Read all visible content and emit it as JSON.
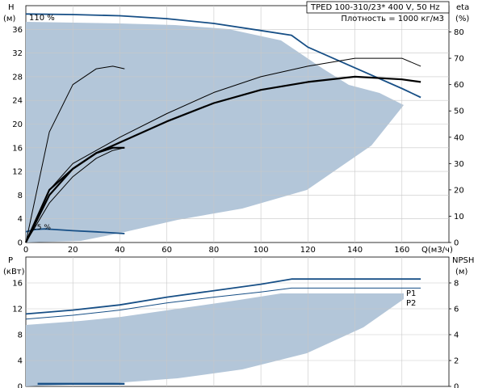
{
  "chart_data": [
    {
      "type": "line",
      "legend_box": {
        "model": "TPED 100-310/2",
        "supply": "3* 400 V, 50 Hz",
        "density": "Плотность = 1000 кг/м3"
      },
      "x_axis": {
        "label": "Q(м3/ч)",
        "range": [
          0,
          180
        ],
        "ticks": [
          0,
          20,
          40,
          60,
          80,
          100,
          120,
          140,
          160
        ]
      },
      "y_left": {
        "label": "H",
        "unit": "(м)",
        "range": [
          0,
          40
        ],
        "ticks": [
          0,
          4,
          8,
          12,
          16,
          20,
          24,
          28,
          32,
          36
        ]
      },
      "y_right": {
        "label": "eta",
        "unit": "(%)",
        "range": [
          0,
          90
        ],
        "ticks": [
          0,
          10,
          20,
          30,
          40,
          50,
          60,
          70,
          80
        ]
      },
      "annotations": {
        "max_speed": "110 %",
        "min_speed": "25 %"
      },
      "grid": true,
      "series": [
        {
          "role": "H",
          "x": [
            0,
            20,
            40,
            60,
            80,
            100,
            113,
            120,
            140,
            160,
            168
          ],
          "y": [
            38.6,
            38.5,
            38.3,
            37.8,
            37.0,
            35.8,
            35.0,
            33.0,
            29.5,
            26.0,
            24.5
          ]
        },
        {
          "role": "H",
          "x": [
            0,
            4,
            8,
            12,
            16,
            20,
            30,
            42
          ],
          "y": [
            1.8,
            2.2,
            2.3,
            2.2,
            2.1,
            2.0,
            1.8,
            1.5
          ]
        },
        {
          "role": "eta",
          "x": [
            0,
            10,
            20,
            30,
            40,
            60,
            80,
            100,
            120,
            140,
            160,
            168
          ],
          "y": [
            0,
            20,
            30,
            35,
            40,
            49,
            57,
            63,
            67,
            70,
            70,
            67
          ]
        },
        {
          "role": "eta",
          "x": [
            0,
            10,
            20,
            30,
            40,
            60,
            80,
            100,
            120,
            140,
            160,
            168
          ],
          "y": [
            0,
            18,
            28,
            34,
            38,
            46,
            53,
            58,
            61,
            63,
            62,
            61
          ]
        },
        {
          "role": "eta",
          "x": [
            0,
            10,
            20,
            30,
            37,
            42
          ],
          "y": [
            0,
            42,
            60,
            66,
            67,
            66
          ]
        },
        {
          "role": "eta",
          "x": [
            0,
            10,
            20,
            30,
            37,
            42
          ],
          "y": [
            0,
            20,
            28,
            34,
            36,
            36
          ]
        },
        {
          "role": "eta",
          "x": [
            0,
            10,
            20,
            30,
            37,
            42
          ],
          "y": [
            0,
            15,
            25,
            32,
            35,
            36
          ]
        }
      ]
    },
    {
      "type": "line",
      "x_axis": {
        "range": [
          0,
          180
        ]
      },
      "y_left": {
        "label": "P",
        "unit": "(кВт)",
        "range": [
          0,
          20
        ],
        "ticks": [
          0,
          4,
          8,
          12,
          16
        ]
      },
      "y_right": {
        "label": "NPSH",
        "unit": "(м)",
        "range": [
          0,
          10
        ],
        "ticks": [
          0,
          2,
          4,
          6,
          8
        ]
      },
      "grid": true,
      "series": [
        {
          "name": "P1",
          "x": [
            0,
            20,
            40,
            60,
            80,
            100,
            113,
            120,
            140,
            160,
            168
          ],
          "y": [
            11.2,
            11.8,
            12.6,
            13.8,
            14.8,
            15.8,
            16.6,
            16.6,
            16.6,
            16.6,
            16.6
          ]
        },
        {
          "name": "P2",
          "x": [
            0,
            20,
            40,
            60,
            80,
            100,
            113,
            120,
            140,
            160,
            168
          ],
          "y": [
            10.4,
            11.0,
            11.8,
            12.9,
            13.8,
            14.6,
            15.2,
            15.2,
            15.2,
            15.2,
            15.2
          ]
        },
        {
          "role": "NPSH",
          "x": [
            5,
            42
          ],
          "y": [
            0.2,
            0.2
          ]
        }
      ]
    }
  ]
}
